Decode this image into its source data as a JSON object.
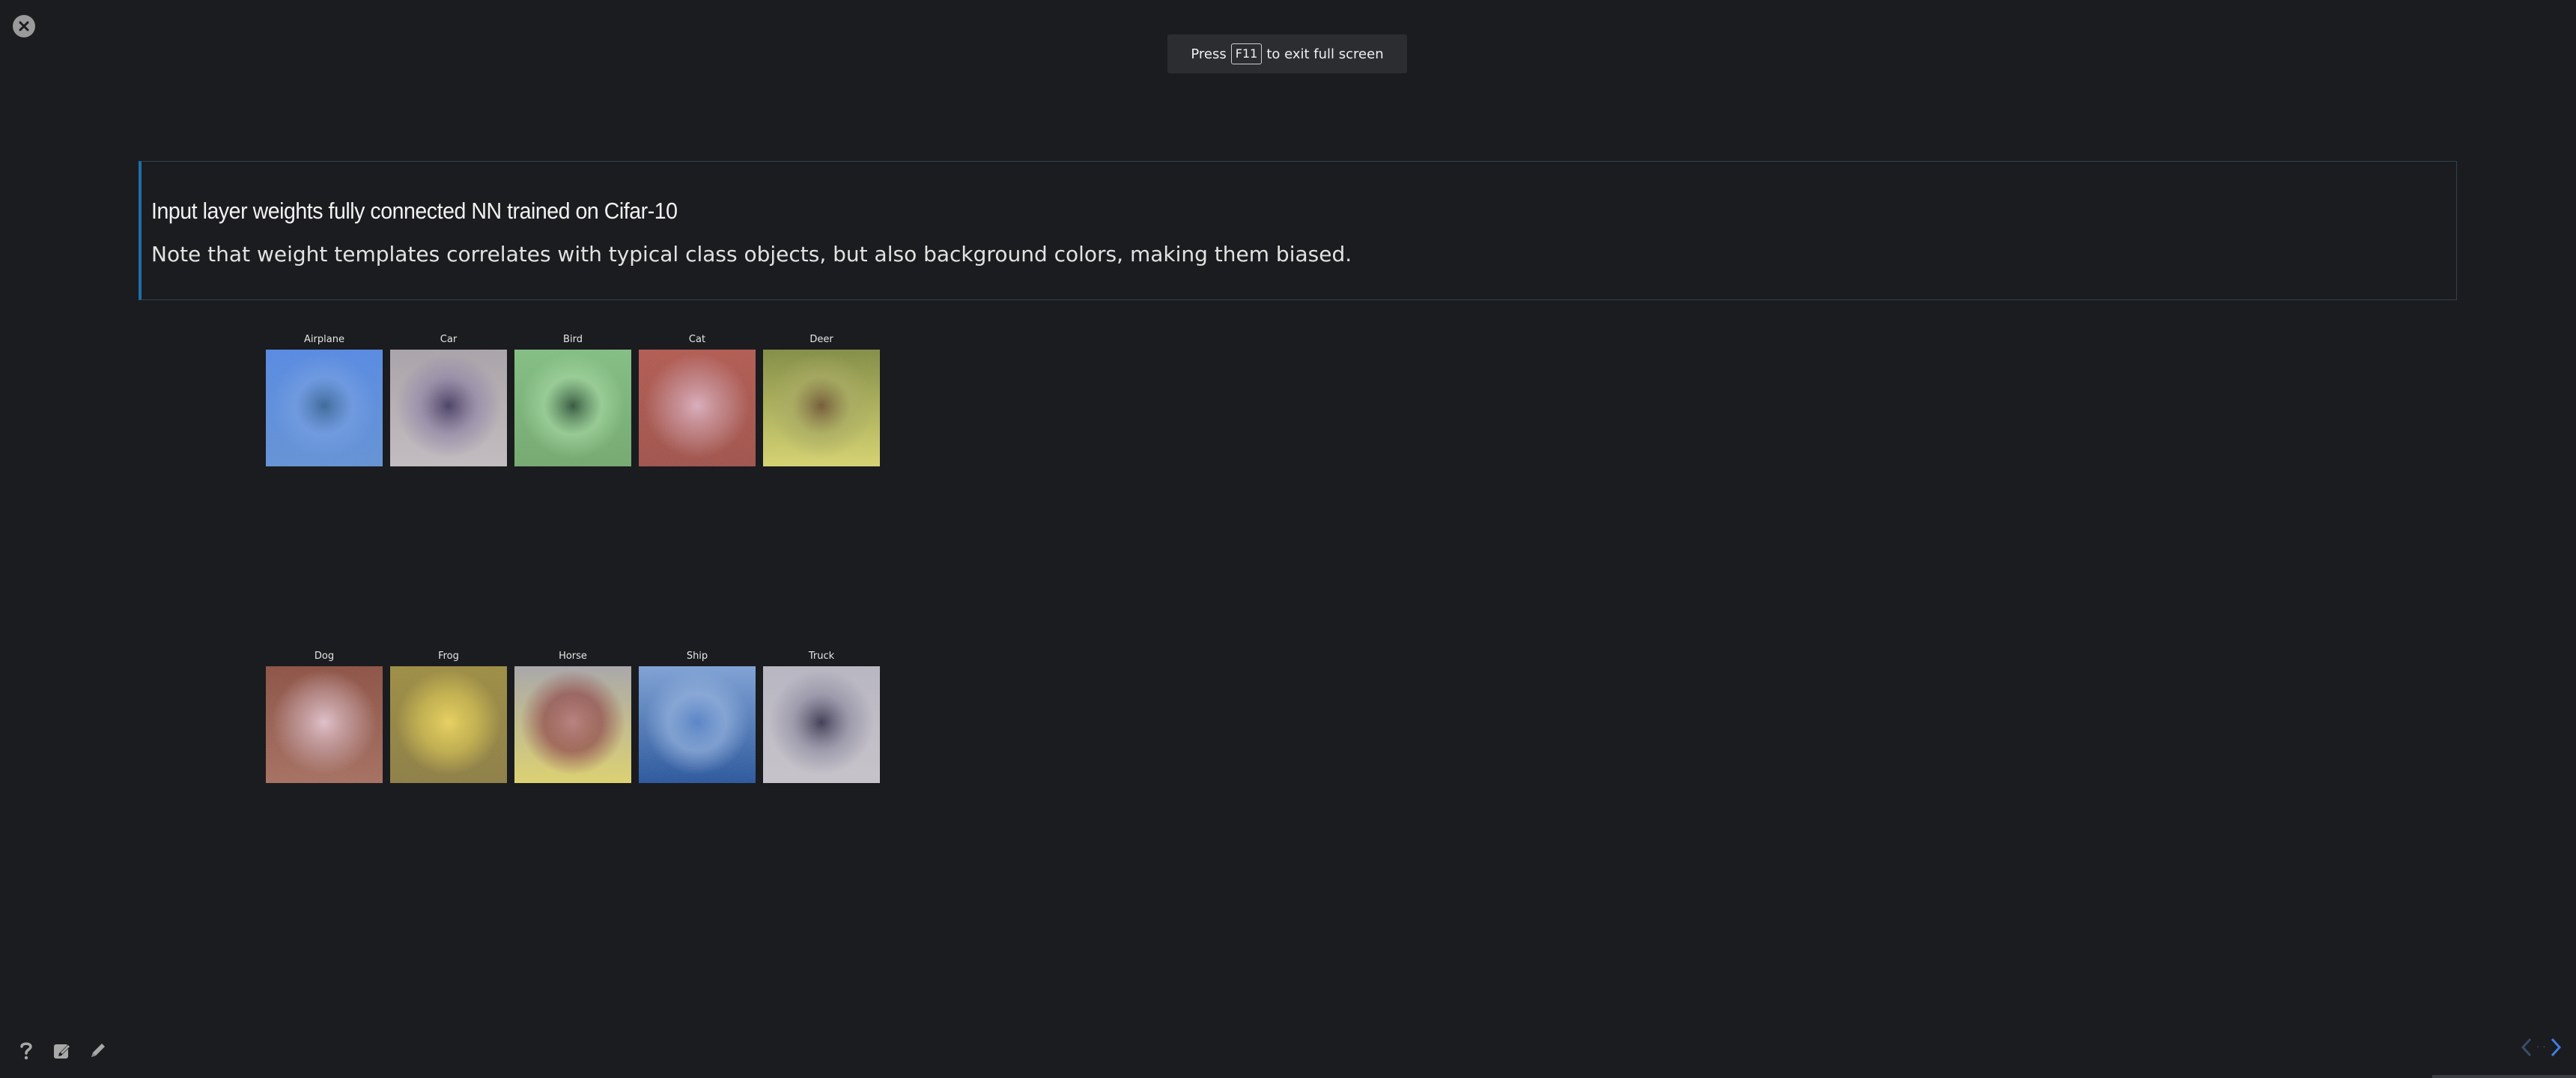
{
  "toast": {
    "prefix": "Press",
    "key": "F11",
    "suffix": "to exit full screen"
  },
  "slide": {
    "title": "Input layer weights fully connected NN trained on Cifar-10",
    "note": "Note that weight templates correlates with typical class objects, but also background colors, making them biased."
  },
  "classes": [
    {
      "label": "Airplane",
      "colors": [
        "#4f86e6",
        "#6d9be6",
        "#2f5f93",
        "#5d8fd8"
      ]
    },
    {
      "label": "Car",
      "colors": [
        "#a8a2a8",
        "#8c80a5",
        "#3b2f57",
        "#c4bcc0"
      ]
    },
    {
      "label": "Bird",
      "colors": [
        "#7fbf7f",
        "#9fd89c",
        "#244a2f",
        "#6fa86a"
      ]
    },
    {
      "label": "Cat",
      "colors": [
        "#b2544a",
        "#c78a90",
        "#e0b3c4",
        "#9e4c43"
      ]
    },
    {
      "label": "Deer",
      "colors": [
        "#7f8a3c",
        "#a6a85a",
        "#6b4e2a",
        "#d9d66b"
      ]
    },
    {
      "label": "Dog",
      "colors": [
        "#8a4a3c",
        "#c49a9c",
        "#e8c7d4",
        "#a46a5a"
      ]
    },
    {
      "label": "Frog",
      "colors": [
        "#9b8a3a",
        "#d8c24a",
        "#f0d85a",
        "#8a7a3c"
      ]
    },
    {
      "label": "Horse",
      "colors": [
        "#a8a6a8",
        "#8a3a3e",
        "#b87a78",
        "#e0d46a"
      ]
    },
    {
      "label": "Ship",
      "colors": [
        "#7aa0d8",
        "#8fb0e0",
        "#4f7fc8",
        "#1f4f9a"
      ]
    },
    {
      "label": "Truck",
      "colors": [
        "#b8b6c2",
        "#8c8aa0",
        "#2f2a45",
        "#c8c4cc"
      ]
    }
  ],
  "nav": {
    "dots": "· ·"
  },
  "colors": {
    "background": "#1b1c1f",
    "accent": "#1e6fa8"
  },
  "icons": {
    "close": "close-icon",
    "help": "help-icon",
    "edit": "edit-icon",
    "pen": "pen-icon",
    "prev": "chevron-left-icon",
    "next": "chevron-right-icon"
  }
}
